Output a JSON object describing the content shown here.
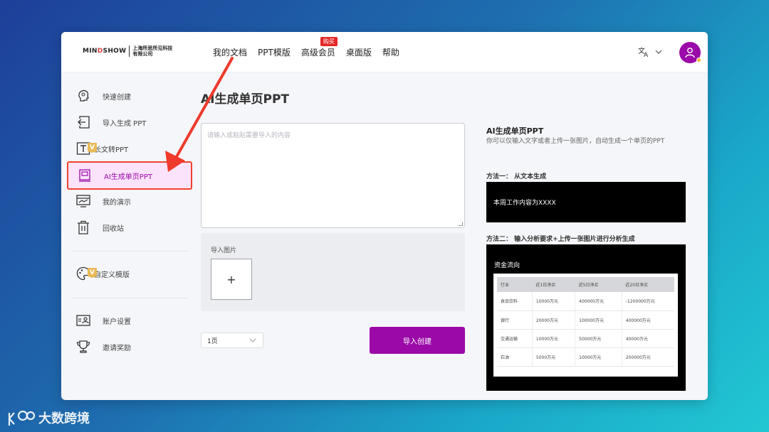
{
  "header": {
    "logo_main": "MINDSHOW",
    "logo_sub": "上海所思所见科技有限公司",
    "nav": [
      {
        "label": "我的文档"
      },
      {
        "label": "PPT模版"
      },
      {
        "label": "高级会员",
        "badge": "购买"
      },
      {
        "label": "桌面版"
      },
      {
        "label": "帮助"
      }
    ],
    "lang_icon": "translate-icon"
  },
  "sidebar": {
    "items": [
      {
        "label": "快速创建",
        "icon": "brain-icon"
      },
      {
        "label": "导入生成 PPT",
        "icon": "import-icon"
      },
      {
        "label": "长文转PPT",
        "icon": "text-icon",
        "vip": "V"
      },
      {
        "label": "AI生成单页PPT",
        "icon": "slide-icon",
        "active": true
      },
      {
        "label": "我的演示",
        "icon": "presentation-icon"
      },
      {
        "label": "回收站",
        "icon": "trash-icon"
      },
      {
        "label": "自定义模版",
        "icon": "palette-icon",
        "vip": "V"
      },
      {
        "label": "账户设置",
        "icon": "account-icon"
      },
      {
        "label": "邀请奖励",
        "icon": "trophy-icon"
      }
    ]
  },
  "main": {
    "title": "AI生成单页PPT",
    "textarea_placeholder": "请输入或粘贴需要导入的内容",
    "upload_label": "导入图片",
    "upload_plus": "+",
    "page_select": "1页",
    "create_button": "导入创建"
  },
  "right_panel": {
    "title": "AI生成单页PPT",
    "description": "你可以仅输入文字或者上传一张图片，自动生成一个单页的PPT",
    "method1_label": "方法一： 从文本生成",
    "method1_example": "本周工作内容为XXXX",
    "method2_label": "方法二： 输入分析要求+上传一张图片进行分析生成",
    "method2_title": "资金流向",
    "table": {
      "headers": [
        "行业",
        "近1日净买",
        "近5日净买",
        "近20日净买"
      ],
      "rows": [
        [
          "食品饮料",
          "10000万元",
          "400000万元",
          "-1200000万元"
        ],
        [
          "银行",
          "20000万元",
          "100000万元",
          "400000万元"
        ],
        [
          "交通运输",
          "10000万元",
          "50000万元",
          "40000万元"
        ],
        [
          "石油",
          "5000万元",
          "10000万元",
          "200000万元"
        ]
      ]
    }
  },
  "watermark": "大数跨境",
  "colors": {
    "accent": "#9b0aa8",
    "highlight": "#f0412e",
    "active_bg": "#fbe3fb"
  }
}
